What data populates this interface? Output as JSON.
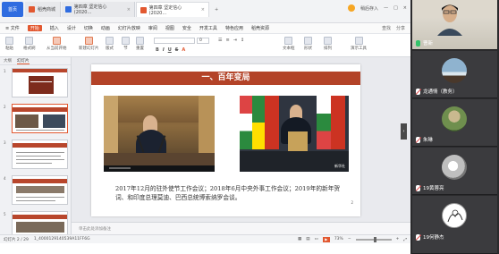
{
  "titlebar": {
    "home_tab": "首页",
    "tabs": [
      {
        "label": "稻壳商城",
        "color": "#e25830"
      },
      {
        "label": "第四章 坚定信心 (2020…",
        "color": "#2f6ce0"
      },
      {
        "label": "第四章 坚定信心 (2020…",
        "color": "#e25830"
      }
    ],
    "right_text": "稍后存入"
  },
  "menubar": {
    "items": [
      "≡ 文件",
      "开始",
      "插入",
      "设计",
      "切换",
      "动画",
      "幻灯片放映",
      "审阅",
      "视图",
      "安全",
      "开发工具",
      "特色应用",
      "稻壳资源"
    ],
    "active_index": 1,
    "right_items": [
      "查找",
      "分享"
    ]
  },
  "ribbon": {
    "paste_label": "粘贴",
    "format_painter_label": "格式刷",
    "from_current_label": "从当前开始",
    "new_slide_label": "新建幻灯片",
    "layout_label": "版式",
    "section_label": "节",
    "reset_label": "重置",
    "font_name": "",
    "font_size": "0",
    "text_box_label": "文本框",
    "shape_label": "形状",
    "arrange_label": "排列",
    "quick_styles_label": "演示工具"
  },
  "left_pane": {
    "tab_outline": "大纲",
    "tab_slides": "幻灯片",
    "slides": [
      {
        "num": "1"
      },
      {
        "num": "2",
        "selected": true
      },
      {
        "num": "3"
      },
      {
        "num": "4"
      },
      {
        "num": "5"
      }
    ]
  },
  "slide": {
    "title": "一、百年变局",
    "caption": "2017年12月的驻外使节工作会议；2018年6月中央外事工作会议；2019年的新年贺词、和印度总理莫迪、巴西总统博索纳罗会谈。",
    "page_number": "2",
    "watermark": "新华社"
  },
  "notes_placeholder": "单击此处添加备注",
  "statusbar": {
    "slide_info": "幻灯片 2 / 29",
    "theme": "1_4000129140539A11FF6G",
    "zoom": "73%",
    "zoom_fraction": 0.55
  },
  "participants": [
    {
      "name": "曹新",
      "mic": "on",
      "kind": "video"
    },
    {
      "name": "龙通情（教务）",
      "mic": "off",
      "kind": "avatar",
      "avatar_colors": [
        "#8fb3cf",
        "#dce7ee",
        "#49382b"
      ]
    },
    {
      "name": "朱琳",
      "mic": "off",
      "kind": "avatar",
      "avatar_colors": [
        "#6f8f4e",
        "#c9b98f",
        "#3e5a2c"
      ]
    },
    {
      "name": "19黄蓉亮",
      "mic": "off",
      "kind": "avatar",
      "avatar_colors": [
        "#e5e5e5",
        "#bfbfbf",
        "#777777"
      ]
    },
    {
      "name": "19何静杰",
      "mic": "off",
      "kind": "avatar",
      "avatar_colors": [
        "#ffffff",
        "#d0d0d0",
        "#555555"
      ]
    }
  ]
}
